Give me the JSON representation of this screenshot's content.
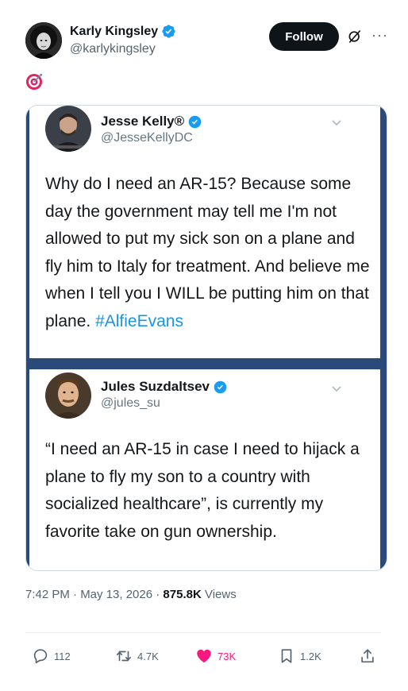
{
  "post": {
    "author": {
      "display_name": "Karly Kingsley",
      "handle": "@karlykingsley",
      "verified": true
    },
    "follow_label": "Follow",
    "more_label": "···",
    "emoji": "🎯",
    "timestamp": "7:42 PM · May 13, 2026 · ",
    "views_count": "875.8K",
    "views_label": " Views"
  },
  "embedded": [
    {
      "display_name": "Jesse Kelly®",
      "handle": "@JesseKellyDC",
      "text": "Why do I need an AR-15? Because some day the government may tell me I'm not allowed to put my sick son on a plane and fly him to Italy for treatment. And believe me when I tell you I WILL be putting him on that plane. ",
      "hashtag": "#AlfieEvans"
    },
    {
      "display_name": "Jules Suzdaltsev",
      "handle": "@jules_su",
      "text": "“I need an AR-15 in case I need to hijack a plane to fly my son to a country with socialized healthcare”, is currently my favorite take on gun ownership."
    }
  ],
  "actions": {
    "replies": "112",
    "reposts": "4.7K",
    "likes": "73K",
    "bookmarks": "1.2K"
  },
  "colors": {
    "verified_blue": "#1d9bf0",
    "like_pink": "#f91880",
    "frame_navy": "#2a4a7a",
    "hashtag_blue": "#1b95e0"
  },
  "icons": [
    "verified-badge-icon",
    "grok-icon",
    "more-icon",
    "target-emoji",
    "chevron-down-icon",
    "reply-icon",
    "repost-icon",
    "like-icon",
    "bookmark-icon",
    "share-icon"
  ]
}
